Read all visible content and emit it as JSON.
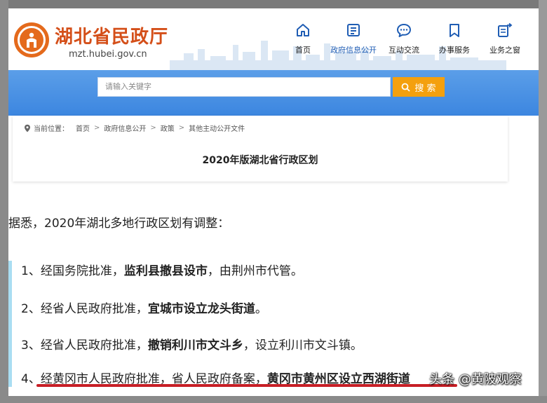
{
  "header": {
    "site_name": "湖北省民政厅",
    "site_domain": "mzt.hubei.gov.cn"
  },
  "nav": [
    {
      "label": "首页",
      "icon": "home-icon",
      "active": false
    },
    {
      "label": "政府信息公开",
      "icon": "document-list-icon",
      "active": true
    },
    {
      "label": "互动交流",
      "icon": "chat-bubble-icon",
      "active": false
    },
    {
      "label": "办事服务",
      "icon": "bookmark-icon",
      "active": false
    },
    {
      "label": "业务之窗",
      "icon": "window-export-icon",
      "active": false
    }
  ],
  "search": {
    "placeholder": "请输入关键字",
    "button_label": "搜 索"
  },
  "breadcrumb": {
    "prefix": "当前位置：",
    "items": [
      "首页",
      "政府信息公开",
      "政策",
      "其他主动公开文件"
    ],
    "separator": ">"
  },
  "document": {
    "title": "2020年版湖北省行政区划"
  },
  "article": {
    "intro": "据悉，2020年湖北多地行政区划有调整：",
    "items": [
      {
        "plain": "1、经国务院批准，",
        "bold": "监利县撤县设市",
        "tail": "，由荆州市代管。"
      },
      {
        "plain": "2、经省人民政府批准，",
        "bold": "宜城市设立龙头街道",
        "tail": "。"
      },
      {
        "plain": "3、经省人民政府批准，",
        "bold": "撤销利川市文斗乡",
        "tail": "，设立利川市文斗镇。"
      },
      {
        "plain": "4、经黄冈市人民政府批准，省人民政府备案，",
        "bold": "黄冈市黄州区设立西湖街道",
        "tail": ""
      }
    ]
  },
  "watermark": "头条 @黄陂观察",
  "colors": {
    "brand_orange": "#d44f19",
    "nav_active": "#1f5db4",
    "search_band": "#3c86e0",
    "search_button": "#f4a00e",
    "list_bar": "#a9ddf2",
    "underline": "#c71e25"
  }
}
